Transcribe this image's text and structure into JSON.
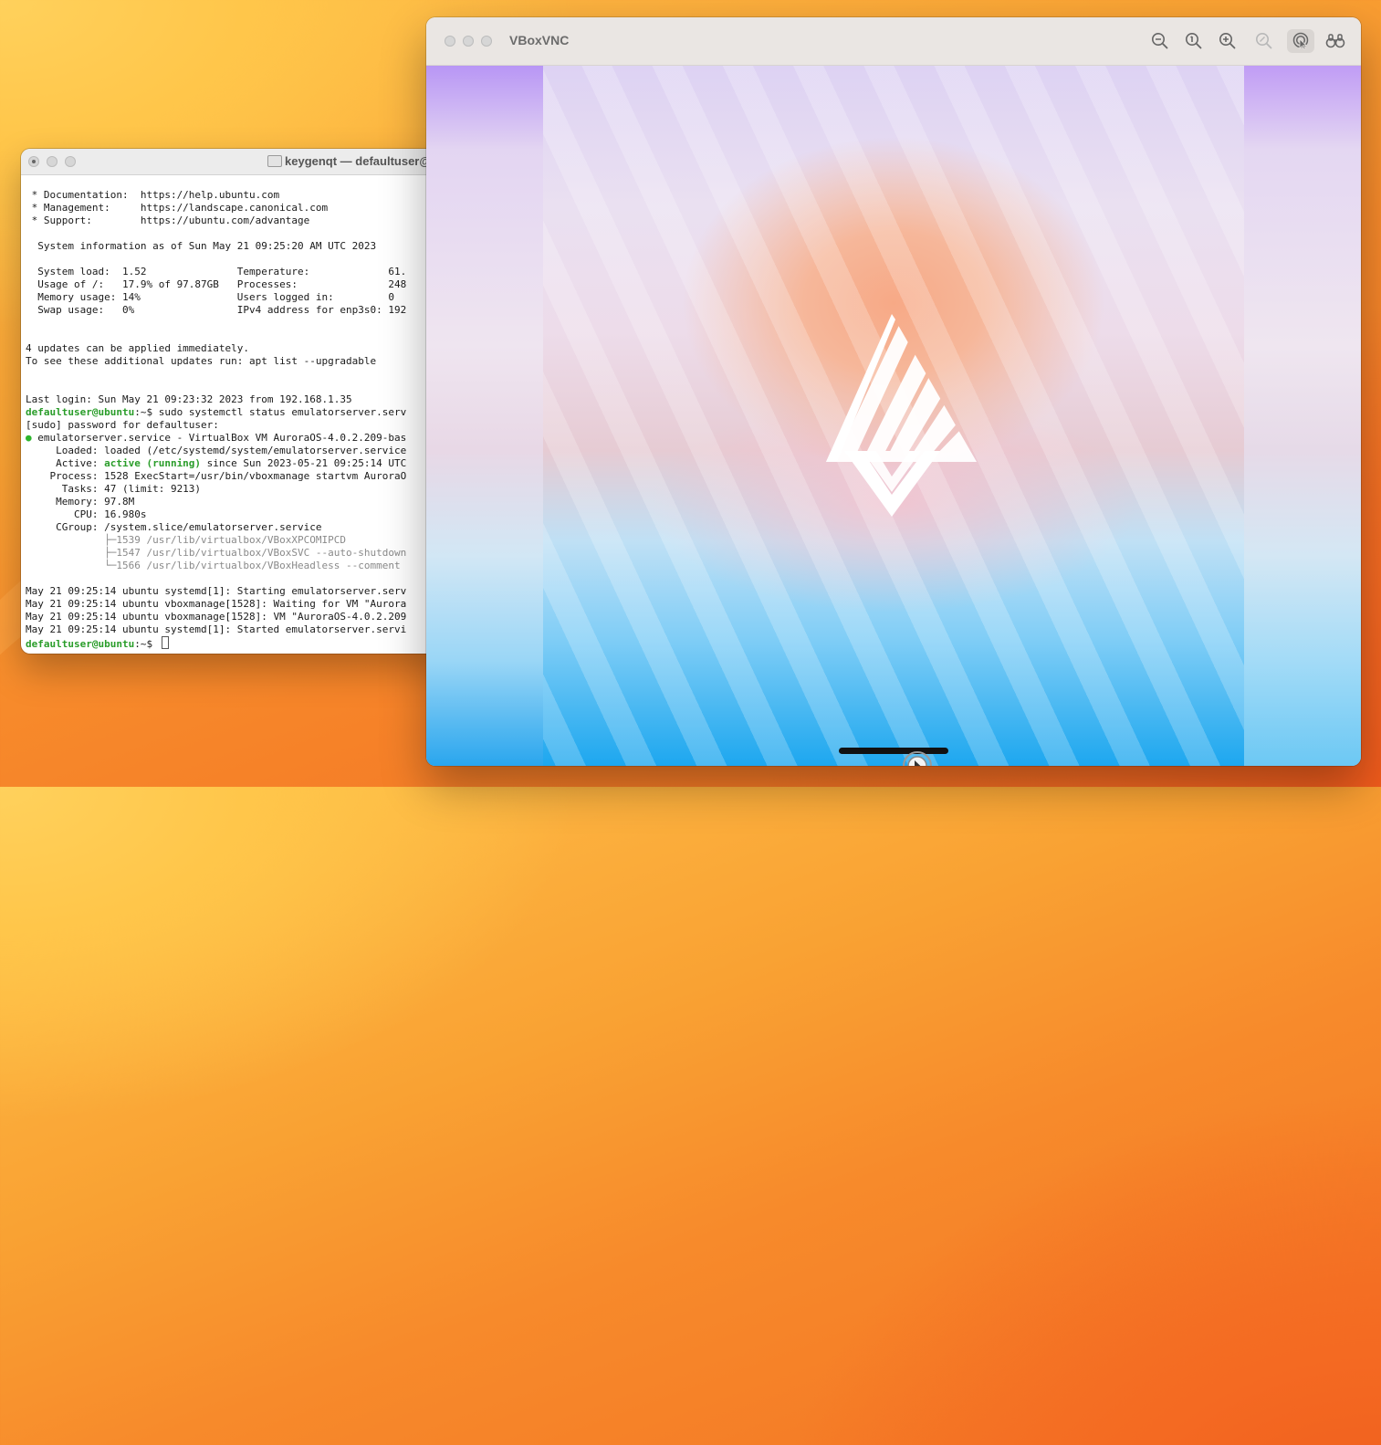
{
  "terminal": {
    "title": "keygenqt — defaultuser@",
    "lines": [
      [
        {
          "t": " * Documentation:  https://help.ubuntu.com"
        }
      ],
      [
        {
          "t": " * Management:     https://landscape.canonical.com"
        }
      ],
      [
        {
          "t": " * Support:        https://ubuntu.com/advantage"
        }
      ],
      [
        {
          "t": ""
        }
      ],
      [
        {
          "t": "  System information as of Sun May 21 09:25:20 AM UTC 2023"
        }
      ],
      [
        {
          "t": ""
        }
      ],
      [
        {
          "t": "  System load:  1.52               Temperature:             61."
        }
      ],
      [
        {
          "t": "  Usage of /:   17.9% of 97.87GB   Processes:               248"
        }
      ],
      [
        {
          "t": "  Memory usage: 14%                Users logged in:         0"
        }
      ],
      [
        {
          "t": "  Swap usage:   0%                 IPv4 address for enp3s0: 192"
        }
      ],
      [
        {
          "t": ""
        }
      ],
      [
        {
          "t": ""
        }
      ],
      [
        {
          "t": "4 updates can be applied immediately."
        }
      ],
      [
        {
          "t": "To see these additional updates run: apt list --upgradable"
        }
      ],
      [
        {
          "t": ""
        }
      ],
      [
        {
          "t": ""
        }
      ],
      [
        {
          "t": "Last login: Sun May 21 09:23:32 2023 from 192.168.1.35"
        }
      ],
      [
        {
          "t": "defaultuser@ubuntu",
          "c": "green"
        },
        {
          "t": ":~$ sudo systemctl status emulatorserver.serv"
        }
      ],
      [
        {
          "t": "[sudo] password for defaultuser:"
        }
      ],
      [
        {
          "t": "●",
          "c": "dot"
        },
        {
          "t": " emulatorserver.service - VirtualBox VM AuroraOS-4.0.2.209-bas"
        }
      ],
      [
        {
          "t": "     Loaded: loaded (/etc/systemd/system/emulatorserver.service"
        }
      ],
      [
        {
          "t": "     Active: "
        },
        {
          "t": "active (running)",
          "c": "green"
        },
        {
          "t": " since Sun 2023-05-21 09:25:14 UTC"
        }
      ],
      [
        {
          "t": "    Process: 1528 ExecStart=/usr/bin/vboxmanage startvm AuroraO"
        }
      ],
      [
        {
          "t": "      Tasks: 47 (limit: 9213)"
        }
      ],
      [
        {
          "t": "     Memory: 97.8M"
        }
      ],
      [
        {
          "t": "        CPU: 16.980s"
        }
      ],
      [
        {
          "t": "     CGroup: /system.slice/emulatorserver.service"
        }
      ],
      [
        {
          "t": "             ├─",
          "c": "gray"
        },
        {
          "t": "1539 /usr/lib/virtualbox/VBoxXPCOMIPCD",
          "c": "gray"
        }
      ],
      [
        {
          "t": "             ├─",
          "c": "gray"
        },
        {
          "t": "1547 /usr/lib/virtualbox/VBoxSVC --auto-shutdown",
          "c": "gray"
        }
      ],
      [
        {
          "t": "             └─",
          "c": "gray"
        },
        {
          "t": "1566 /usr/lib/virtualbox/VBoxHeadless --comment",
          "c": "gray"
        }
      ],
      [
        {
          "t": ""
        }
      ],
      [
        {
          "t": "May 21 09:25:14 ubuntu systemd[1]: Starting emulatorserver.serv"
        }
      ],
      [
        {
          "t": "May 21 09:25:14 ubuntu vboxmanage[1528]: Waiting for VM \"Aurora"
        }
      ],
      [
        {
          "t": "May 21 09:25:14 ubuntu vboxmanage[1528]: VM \"AuroraOS-4.0.2.209"
        }
      ],
      [
        {
          "t": "May 21 09:25:14 ubuntu systemd[1]: Started emulatorserver.servi"
        }
      ],
      [
        {
          "t": "defaultuser@ubuntu",
          "c": "green"
        },
        {
          "t": ":~$ "
        }
      ]
    ]
  },
  "vnc": {
    "title": "VBoxVNC",
    "toolbar": [
      {
        "name": "zoom-out-icon"
      },
      {
        "name": "zoom-actual-size-icon"
      },
      {
        "name": "zoom-in-icon"
      },
      {
        "name": "zoom-to-fit-icon"
      },
      {
        "name": "remote-control-icon"
      },
      {
        "name": "binoculars-icon"
      }
    ]
  },
  "colors": {
    "prompt_green": "#2a9d2a",
    "status_dot": "#2db52d"
  }
}
